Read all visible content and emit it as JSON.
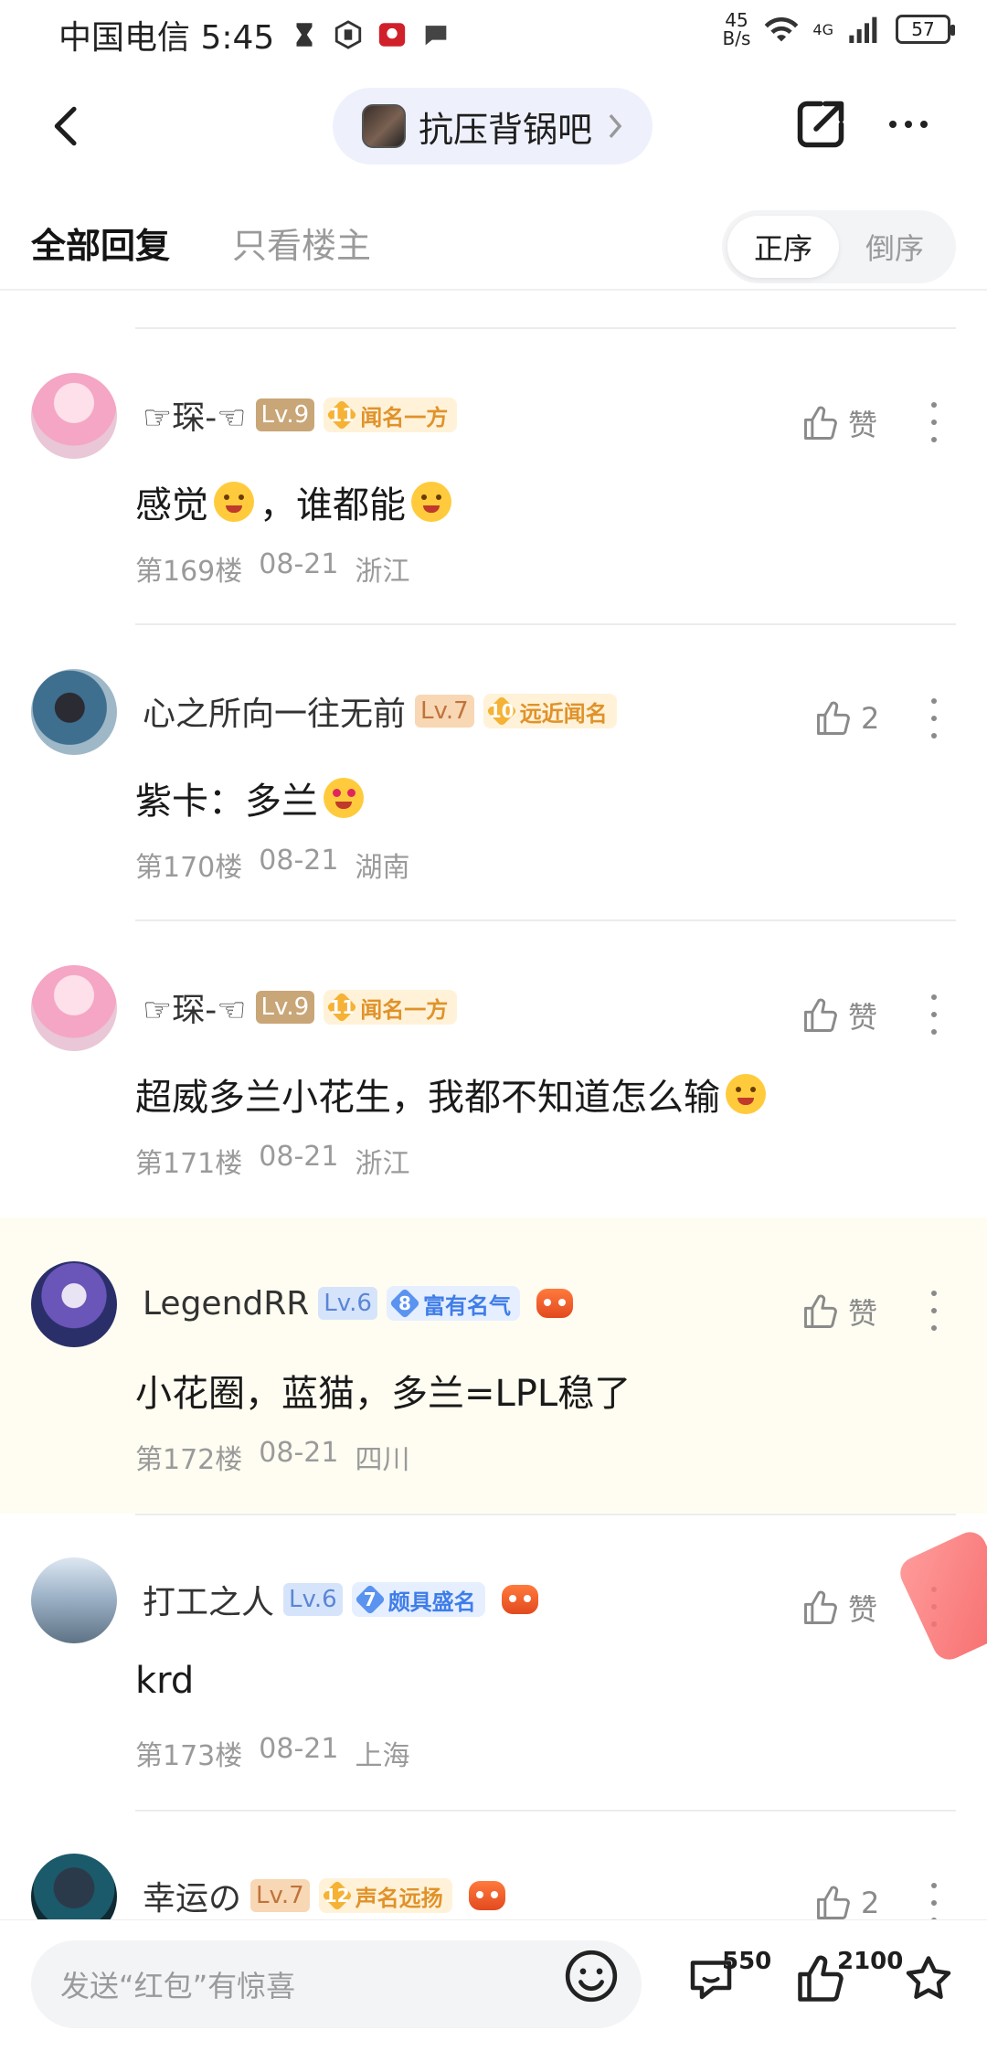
{
  "status_bar": {
    "carrier_time": "中国电信 5:45",
    "speed_value": "45",
    "speed_unit": "B/s",
    "network": "4G",
    "battery": "57"
  },
  "nav": {
    "forum_name": "抗压背锅吧",
    "back_icon": "back-arrow-icon",
    "share_icon": "share-icon",
    "more_icon": "more-icon"
  },
  "tabs": {
    "all": "全部回复",
    "op_only": "只看楼主",
    "sort_asc": "正序",
    "sort_desc": "倒序"
  },
  "posts": [
    {
      "user": "☞琛-☜",
      "level": "Lv.9",
      "badge_num": "11",
      "badge_text": "闻名一方",
      "badge_color": "#f5b235",
      "likes": "赞",
      "content_pre": "感觉",
      "content_mid": "，谁都能",
      "floor": "第169楼",
      "date": "08-21",
      "region": "浙江"
    },
    {
      "user": "心之所向一往无前",
      "level": "Lv.7",
      "badge_num": "10",
      "badge_text": "远近闻名",
      "badge_color": "#f5b235",
      "likes": "2",
      "content_pre": "紫卡：多兰",
      "floor": "第170楼",
      "date": "08-21",
      "region": "湖南"
    },
    {
      "user": "☞琛-☜",
      "level": "Lv.9",
      "badge_num": "11",
      "badge_text": "闻名一方",
      "badge_color": "#f5b235",
      "likes": "赞",
      "content_pre": "超威多兰小花生，我都不知道怎么输",
      "floor": "第171楼",
      "date": "08-21",
      "region": "浙江"
    },
    {
      "user": "LegendRR",
      "level": "Lv.6",
      "badge_num": "8",
      "badge_text": "富有名气",
      "badge_color": "#5b93f0",
      "likes": "赞",
      "content_pre": "小花圈，蓝猫，多兰=LPL稳了",
      "floor": "第172楼",
      "date": "08-21",
      "region": "四川"
    },
    {
      "user": "打工之人",
      "level": "Lv.6",
      "badge_num": "7",
      "badge_text": "颇具盛名",
      "badge_color": "#5b93f0",
      "likes": "赞",
      "content_pre": "krd",
      "floor": "第173楼",
      "date": "08-21",
      "region": "上海"
    },
    {
      "user": "幸运の",
      "level": "Lv.7",
      "badge_num": "12",
      "badge_text": "声名远扬",
      "badge_color": "#f5b235",
      "likes": "2"
    }
  ],
  "bottom_bar": {
    "placeholder": "发送“红包”有惊喜",
    "comments": "550",
    "likes": "2100"
  }
}
